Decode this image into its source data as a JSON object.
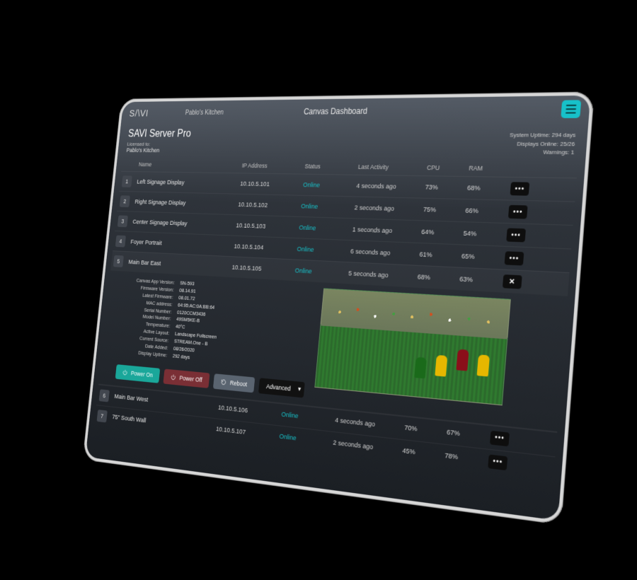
{
  "header": {
    "brand": "SAVI",
    "location": "Pablo's Kitchen",
    "page_title": "Canvas Dashboard"
  },
  "subheader": {
    "product": "SAVI Server Pro",
    "licensed_label": "Licensed to:",
    "licensed_name": "Pablo's Kitchen",
    "uptime_line": "System Uptime: 294 days",
    "displays_line": "Displays Online: 25/26",
    "warnings_line": "Warnings: 1"
  },
  "columns": {
    "name": "Name",
    "ip": "IP Address",
    "status": "Status",
    "last": "Last Activity",
    "cpu": "CPU",
    "ram": "RAM"
  },
  "rows": [
    {
      "idx": "1",
      "name": "Left Signage Display",
      "ip": "10.10.5.101",
      "status": "Online",
      "last": "4 seconds ago",
      "cpu": "73%",
      "ram": "68%"
    },
    {
      "idx": "2",
      "name": "Right Signage Display",
      "ip": "10.10.5.102",
      "status": "Online",
      "last": "2 seconds ago",
      "cpu": "75%",
      "ram": "66%"
    },
    {
      "idx": "3",
      "name": "Center Signage Display",
      "ip": "10.10.5.103",
      "status": "Online",
      "last": "1 seconds ago",
      "cpu": "64%",
      "ram": "54%"
    },
    {
      "idx": "4",
      "name": "Foyer Portrait",
      "ip": "10.10.5.104",
      "status": "Online",
      "last": "6 seconds ago",
      "cpu": "61%",
      "ram": "65%"
    },
    {
      "idx": "5",
      "name": "Main Bar East",
      "ip": "10.10.5.105",
      "status": "Online",
      "last": "5 seconds ago",
      "cpu": "68%",
      "ram": "63%",
      "expanded": true
    },
    {
      "idx": "6",
      "name": "Main Bar West",
      "ip": "10.10.5.106",
      "status": "Online",
      "last": "4 seconds ago",
      "cpu": "70%",
      "ram": "67%"
    },
    {
      "idx": "7",
      "name": "75\" South Wall",
      "ip": "10.10.5.107",
      "status": "Online",
      "last": "2 seconds ago",
      "cpu": "45%",
      "ram": "78%"
    }
  ],
  "detail": {
    "pairs": [
      {
        "k": "Canvas App Version:",
        "v": "SN-593"
      },
      {
        "k": "Firmware Version:",
        "v": "08.14.91"
      },
      {
        "k": "Latest Firmware:",
        "v": "08.01.72"
      },
      {
        "k": "MAC address:",
        "v": "64:95:AC:0A:BB:64"
      },
      {
        "k": "Serial Number:",
        "v": "0120CCM3436"
      },
      {
        "k": "Model Number:",
        "v": "49SM5KE-B"
      },
      {
        "k": "Temperature:",
        "v": "40°C"
      },
      {
        "k": "Active Layout:",
        "v": "Landscape Fullscreen"
      },
      {
        "k": "Current Source:",
        "v": "STREAM.One - B"
      },
      {
        "k": "Date Added:",
        "v": "08/26/2020"
      },
      {
        "k": "Display Uptime:",
        "v": "292 days"
      }
    ]
  },
  "actions": {
    "power_on": "Power On",
    "power_off": "Power Off",
    "reboot": "Reboot",
    "advanced": "Advanced"
  }
}
